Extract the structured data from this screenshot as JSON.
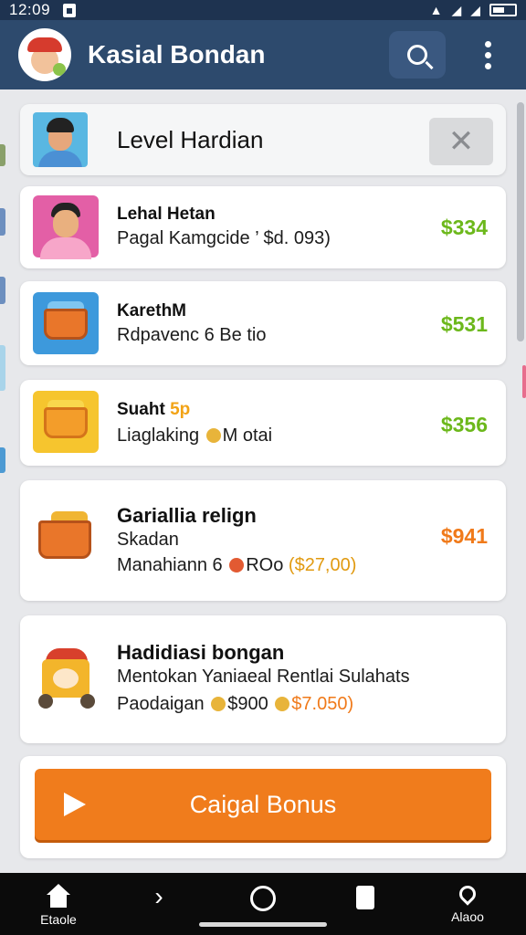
{
  "status_bar": {
    "time": "12:09"
  },
  "app_bar": {
    "title": "Kasial Bondan",
    "search_icon": "search-icon",
    "more_icon": "more-vert-icon"
  },
  "header_card": {
    "title": "Level Hardian",
    "close_label": "✕"
  },
  "tasks": [
    {
      "title": "Lehal Hetan",
      "line1": "Pagal Kamgcide ’ $d. 093)",
      "price": "$334",
      "price_color": "#6cb81b"
    },
    {
      "title": "KarethM",
      "line1": "Rdpavenc 6 Be tio",
      "price": "$531",
      "price_color": "#6cb81b"
    },
    {
      "title": "Suaht",
      "title_accent": "5p",
      "line1_a": "Liaglaking",
      "line1_b": "M otai",
      "price": "$356",
      "price_color": "#6cb81b"
    },
    {
      "title": "Gariallia relign",
      "line1": "Skadan",
      "line2_a": "Manahiann 6",
      "line2_b": "ROo",
      "line2_c": "($27,00)",
      "price": "$941",
      "price_color": "#f07a1a"
    },
    {
      "title": "Hadidiasi bongan",
      "line1": "Mentokan Yaniaeal Rentlai Sulahats",
      "line2_a": "Paodaigan",
      "line2_b": "$900",
      "line2_c": "$7.050)"
    }
  ],
  "cta": {
    "label": "Caigal Bonus"
  },
  "bottom_nav": {
    "home_label": "Etaole",
    "map_label": "Alaoo"
  }
}
